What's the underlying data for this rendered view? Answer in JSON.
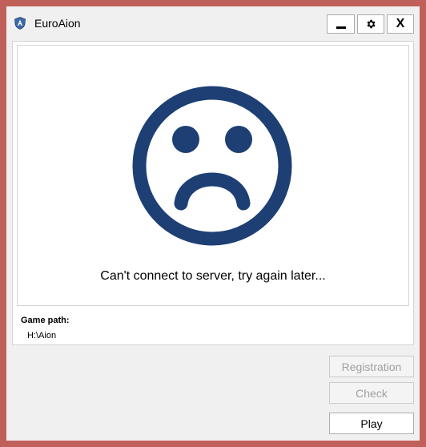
{
  "window": {
    "title": "EuroAion",
    "app_icon": "shield-logo-icon",
    "title_buttons": {
      "minimize": "minimize-icon",
      "settings": "gear-icon",
      "close_label": "X"
    }
  },
  "main": {
    "status_icon": "sad-face-icon",
    "message": "Can't connect to server, try again later...",
    "game_path_label": "Game path:",
    "game_path_value": "H:\\Aion"
  },
  "actions": {
    "registration_label": "Registration",
    "check_label": "Check",
    "play_label": "Play"
  },
  "colors": {
    "frame": "#c0605a",
    "face": "#1e3f74",
    "window_bg": "#f0f0f0"
  }
}
